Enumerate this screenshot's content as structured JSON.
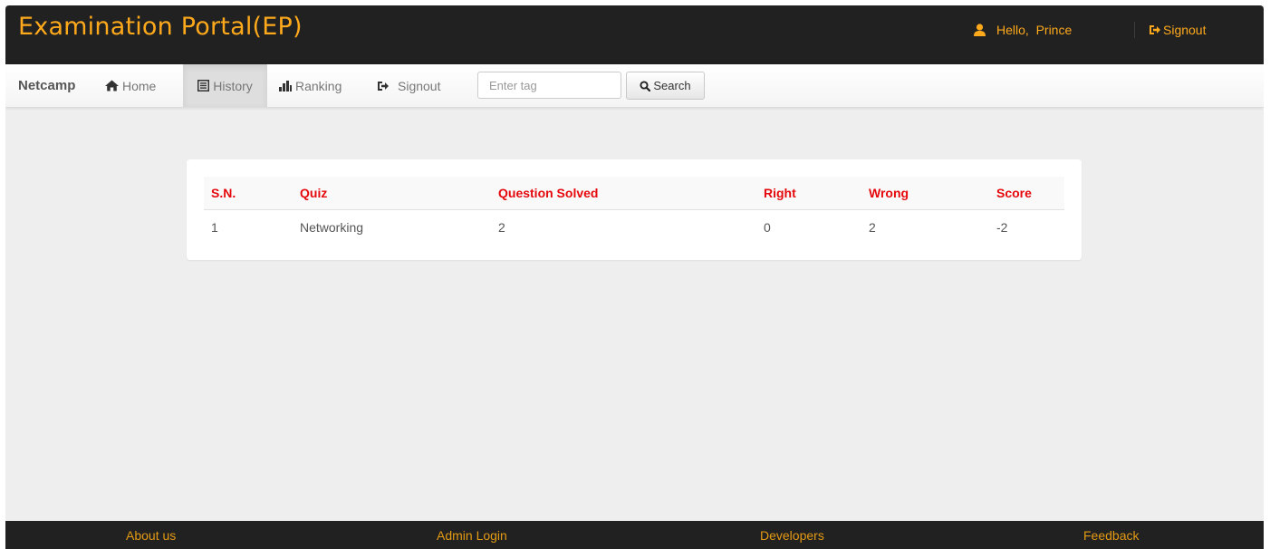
{
  "header": {
    "brand_title": "Examination Portal(EP)",
    "greeting": "Hello,  Prince",
    "signout_label": "Signout"
  },
  "navbar": {
    "brand": "Netcamp",
    "items": [
      {
        "label": "Home",
        "icon": "home-icon",
        "active": false
      },
      {
        "label": "History",
        "icon": "list-icon",
        "active": true
      },
      {
        "label": "Ranking",
        "icon": "bar-chart-icon",
        "active": false
      },
      {
        "label": "Signout",
        "icon": "signout-icon",
        "active": false
      }
    ],
    "search": {
      "placeholder": "Enter tag",
      "value": "",
      "button_label": "Search"
    }
  },
  "history": {
    "columns": [
      "S.N.",
      "Quiz",
      "Question Solved",
      "Right",
      "Wrong",
      "Score"
    ],
    "rows": [
      {
        "sn": "1",
        "quiz": "Networking",
        "solved": "2",
        "right": "0",
        "wrong": "2",
        "score": "-2"
      }
    ]
  },
  "footer": {
    "links": [
      "About us",
      "Admin Login",
      "Developers",
      "Feedback"
    ]
  },
  "colors": {
    "accent": "#fea91c",
    "header_bg": "#212121",
    "table_header_text": "#e5080c",
    "page_bg": "#eeeeee"
  }
}
